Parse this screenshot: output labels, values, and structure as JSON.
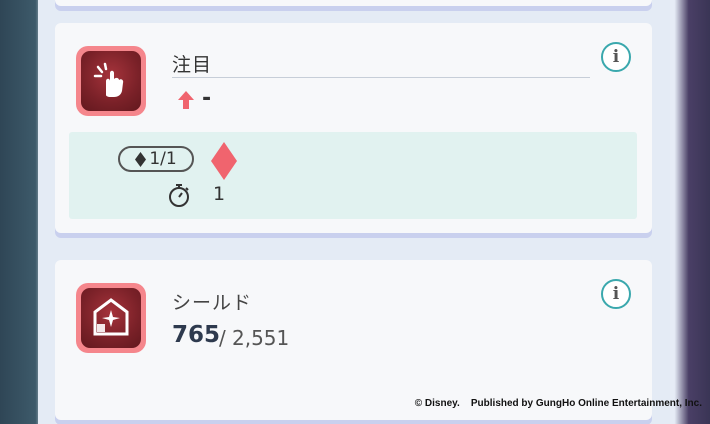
{
  "skills": [
    {
      "icon": "tap-hand-icon",
      "name": "注目",
      "change_value": "-",
      "cost": "1/1",
      "duration": "1"
    },
    {
      "icon": "shield-house-icon",
      "name": "シールド",
      "hp_current": "765",
      "hp_separator": "/",
      "hp_max": "2,551"
    }
  ],
  "copyright": "© Disney.    Published by GungHo Online Entertainment, Inc.",
  "colors": {
    "icon_frame": "#f5868c",
    "icon_fill": "#7a2128",
    "accent_red": "#f0646e",
    "info_ring": "#3aa8ad",
    "effect_bg": "#e1f2f0"
  }
}
